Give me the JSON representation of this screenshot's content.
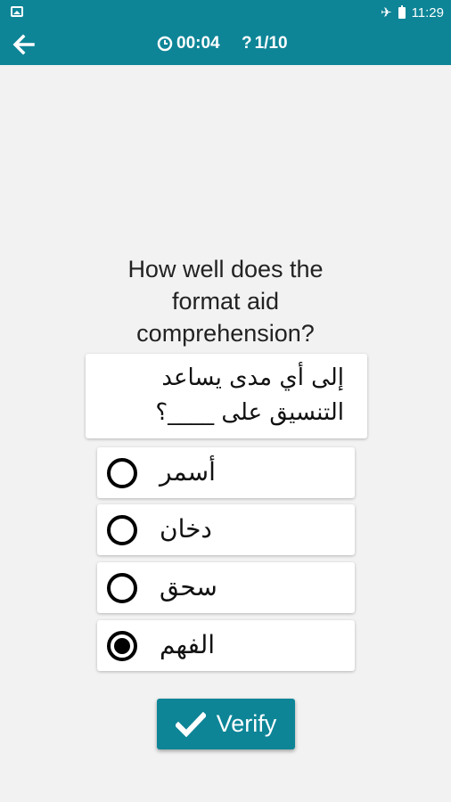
{
  "status_bar": {
    "time": "11:29",
    "icons": [
      "image-icon",
      "airplane-icon",
      "battery-icon"
    ]
  },
  "app_bar": {
    "back_icon": "arrow-left-icon",
    "timer_icon": "clock-icon",
    "timer": "00:04",
    "progress_icon": "question-icon",
    "progress": "1/10",
    "color": "#0d8597"
  },
  "question": {
    "english": "How well does the format aid comprehension?",
    "arabic_line1": "إلى أي مدى يساعد",
    "arabic_line2": "التنسيق على ____؟"
  },
  "options": [
    {
      "label": "أسمر",
      "selected": false
    },
    {
      "label": "دخان",
      "selected": false
    },
    {
      "label": "سحق",
      "selected": false
    },
    {
      "label": "الفهم",
      "selected": true
    }
  ],
  "verify_button": {
    "label": "Verify",
    "icon": "check-icon"
  }
}
